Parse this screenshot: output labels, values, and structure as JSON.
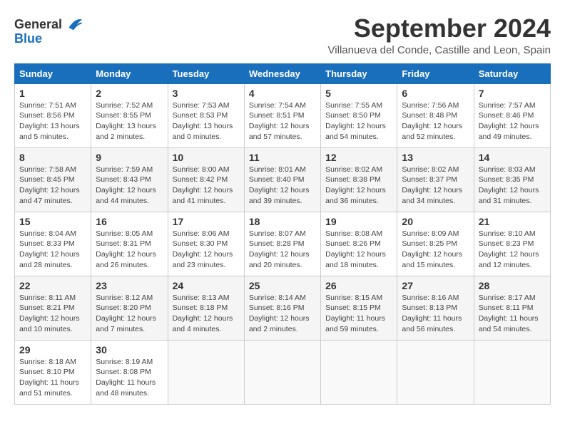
{
  "logo": {
    "general": "General",
    "blue": "Blue"
  },
  "header": {
    "month": "September 2024",
    "location": "Villanueva del Conde, Castille and Leon, Spain"
  },
  "weekdays": [
    "Sunday",
    "Monday",
    "Tuesday",
    "Wednesday",
    "Thursday",
    "Friday",
    "Saturday"
  ],
  "weeks": [
    [
      {
        "day": "1",
        "sunrise": "Sunrise: 7:51 AM",
        "sunset": "Sunset: 8:56 PM",
        "daylight": "Daylight: 13 hours and 5 minutes."
      },
      {
        "day": "2",
        "sunrise": "Sunrise: 7:52 AM",
        "sunset": "Sunset: 8:55 PM",
        "daylight": "Daylight: 13 hours and 2 minutes."
      },
      {
        "day": "3",
        "sunrise": "Sunrise: 7:53 AM",
        "sunset": "Sunset: 8:53 PM",
        "daylight": "Daylight: 13 hours and 0 minutes."
      },
      {
        "day": "4",
        "sunrise": "Sunrise: 7:54 AM",
        "sunset": "Sunset: 8:51 PM",
        "daylight": "Daylight: 12 hours and 57 minutes."
      },
      {
        "day": "5",
        "sunrise": "Sunrise: 7:55 AM",
        "sunset": "Sunset: 8:50 PM",
        "daylight": "Daylight: 12 hours and 54 minutes."
      },
      {
        "day": "6",
        "sunrise": "Sunrise: 7:56 AM",
        "sunset": "Sunset: 8:48 PM",
        "daylight": "Daylight: 12 hours and 52 minutes."
      },
      {
        "day": "7",
        "sunrise": "Sunrise: 7:57 AM",
        "sunset": "Sunset: 8:46 PM",
        "daylight": "Daylight: 12 hours and 49 minutes."
      }
    ],
    [
      {
        "day": "8",
        "sunrise": "Sunrise: 7:58 AM",
        "sunset": "Sunset: 8:45 PM",
        "daylight": "Daylight: 12 hours and 47 minutes."
      },
      {
        "day": "9",
        "sunrise": "Sunrise: 7:59 AM",
        "sunset": "Sunset: 8:43 PM",
        "daylight": "Daylight: 12 hours and 44 minutes."
      },
      {
        "day": "10",
        "sunrise": "Sunrise: 8:00 AM",
        "sunset": "Sunset: 8:42 PM",
        "daylight": "Daylight: 12 hours and 41 minutes."
      },
      {
        "day": "11",
        "sunrise": "Sunrise: 8:01 AM",
        "sunset": "Sunset: 8:40 PM",
        "daylight": "Daylight: 12 hours and 39 minutes."
      },
      {
        "day": "12",
        "sunrise": "Sunrise: 8:02 AM",
        "sunset": "Sunset: 8:38 PM",
        "daylight": "Daylight: 12 hours and 36 minutes."
      },
      {
        "day": "13",
        "sunrise": "Sunrise: 8:02 AM",
        "sunset": "Sunset: 8:37 PM",
        "daylight": "Daylight: 12 hours and 34 minutes."
      },
      {
        "day": "14",
        "sunrise": "Sunrise: 8:03 AM",
        "sunset": "Sunset: 8:35 PM",
        "daylight": "Daylight: 12 hours and 31 minutes."
      }
    ],
    [
      {
        "day": "15",
        "sunrise": "Sunrise: 8:04 AM",
        "sunset": "Sunset: 8:33 PM",
        "daylight": "Daylight: 12 hours and 28 minutes."
      },
      {
        "day": "16",
        "sunrise": "Sunrise: 8:05 AM",
        "sunset": "Sunset: 8:31 PM",
        "daylight": "Daylight: 12 hours and 26 minutes."
      },
      {
        "day": "17",
        "sunrise": "Sunrise: 8:06 AM",
        "sunset": "Sunset: 8:30 PM",
        "daylight": "Daylight: 12 hours and 23 minutes."
      },
      {
        "day": "18",
        "sunrise": "Sunrise: 8:07 AM",
        "sunset": "Sunset: 8:28 PM",
        "daylight": "Daylight: 12 hours and 20 minutes."
      },
      {
        "day": "19",
        "sunrise": "Sunrise: 8:08 AM",
        "sunset": "Sunset: 8:26 PM",
        "daylight": "Daylight: 12 hours and 18 minutes."
      },
      {
        "day": "20",
        "sunrise": "Sunrise: 8:09 AM",
        "sunset": "Sunset: 8:25 PM",
        "daylight": "Daylight: 12 hours and 15 minutes."
      },
      {
        "day": "21",
        "sunrise": "Sunrise: 8:10 AM",
        "sunset": "Sunset: 8:23 PM",
        "daylight": "Daylight: 12 hours and 12 minutes."
      }
    ],
    [
      {
        "day": "22",
        "sunrise": "Sunrise: 8:11 AM",
        "sunset": "Sunset: 8:21 PM",
        "daylight": "Daylight: 12 hours and 10 minutes."
      },
      {
        "day": "23",
        "sunrise": "Sunrise: 8:12 AM",
        "sunset": "Sunset: 8:20 PM",
        "daylight": "Daylight: 12 hours and 7 minutes."
      },
      {
        "day": "24",
        "sunrise": "Sunrise: 8:13 AM",
        "sunset": "Sunset: 8:18 PM",
        "daylight": "Daylight: 12 hours and 4 minutes."
      },
      {
        "day": "25",
        "sunrise": "Sunrise: 8:14 AM",
        "sunset": "Sunset: 8:16 PM",
        "daylight": "Daylight: 12 hours and 2 minutes."
      },
      {
        "day": "26",
        "sunrise": "Sunrise: 8:15 AM",
        "sunset": "Sunset: 8:15 PM",
        "daylight": "Daylight: 11 hours and 59 minutes."
      },
      {
        "day": "27",
        "sunrise": "Sunrise: 8:16 AM",
        "sunset": "Sunset: 8:13 PM",
        "daylight": "Daylight: 11 hours and 56 minutes."
      },
      {
        "day": "28",
        "sunrise": "Sunrise: 8:17 AM",
        "sunset": "Sunset: 8:11 PM",
        "daylight": "Daylight: 11 hours and 54 minutes."
      }
    ],
    [
      {
        "day": "29",
        "sunrise": "Sunrise: 8:18 AM",
        "sunset": "Sunset: 8:10 PM",
        "daylight": "Daylight: 11 hours and 51 minutes."
      },
      {
        "day": "30",
        "sunrise": "Sunrise: 8:19 AM",
        "sunset": "Sunset: 8:08 PM",
        "daylight": "Daylight: 11 hours and 48 minutes."
      },
      null,
      null,
      null,
      null,
      null
    ]
  ]
}
